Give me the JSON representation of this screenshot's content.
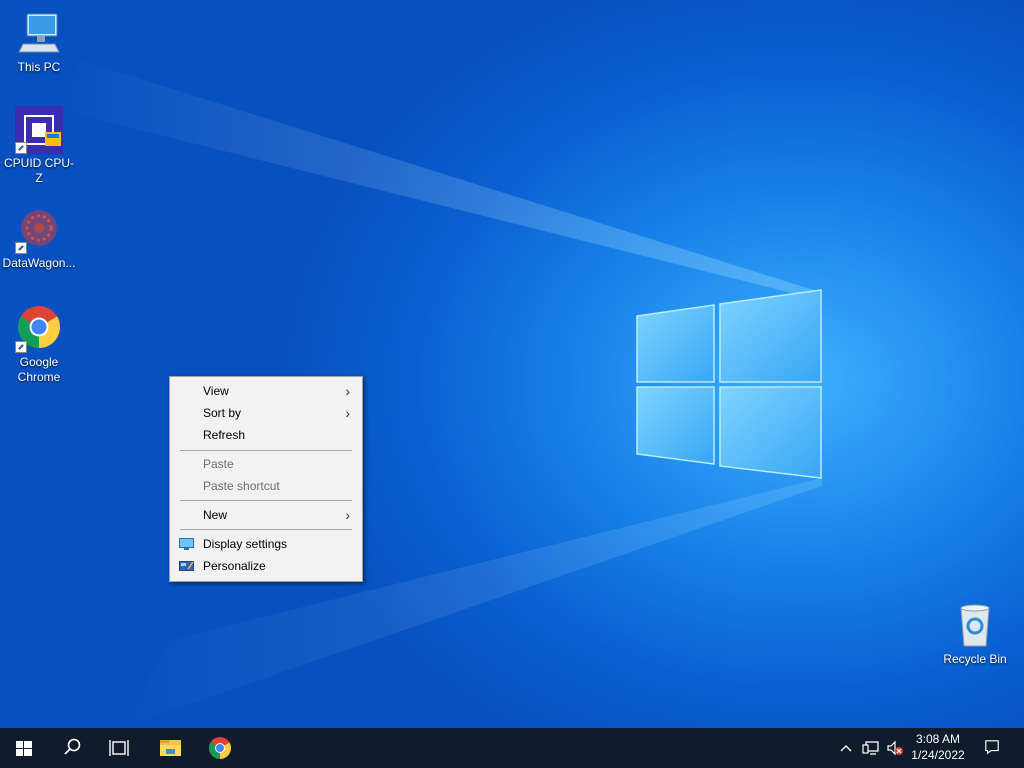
{
  "desktop_icons": [
    {
      "name": "this-pc",
      "label": "This PC"
    },
    {
      "name": "cpuid-cpu-z",
      "label": "CPUID CPU-Z"
    },
    {
      "name": "datawagon",
      "label": "DataWagon..."
    },
    {
      "name": "google-chrome",
      "label": "Google Chrome"
    },
    {
      "name": "recycle-bin",
      "label": "Recycle Bin"
    }
  ],
  "context_menu": {
    "items": [
      {
        "label": "View",
        "submenu": true,
        "enabled": true
      },
      {
        "label": "Sort by",
        "submenu": true,
        "enabled": true
      },
      {
        "label": "Refresh",
        "submenu": false,
        "enabled": true
      },
      {
        "label": "Paste",
        "submenu": false,
        "enabled": false
      },
      {
        "label": "Paste shortcut",
        "submenu": false,
        "enabled": false
      },
      {
        "label": "New",
        "submenu": true,
        "enabled": true
      },
      {
        "label": "Display settings",
        "submenu": false,
        "enabled": true,
        "icon": "display-icon"
      },
      {
        "label": "Personalize",
        "submenu": false,
        "enabled": true,
        "icon": "personalize-icon"
      }
    ]
  },
  "taskbar": {
    "buttons": [
      "start-icon",
      "search-icon",
      "task-view-icon",
      "file-explorer-icon",
      "chrome-icon"
    ],
    "tray": [
      "show-hidden-icons-chevron",
      "network-icon",
      "volume-muted-icon"
    ],
    "time": "3:08 AM",
    "date": "1/24/2022",
    "notifications": "action-center-icon"
  },
  "colors": {
    "taskbar": "#101c2b",
    "menu_bg": "#f2f2f2",
    "desktop_blue": "#1680e8"
  }
}
